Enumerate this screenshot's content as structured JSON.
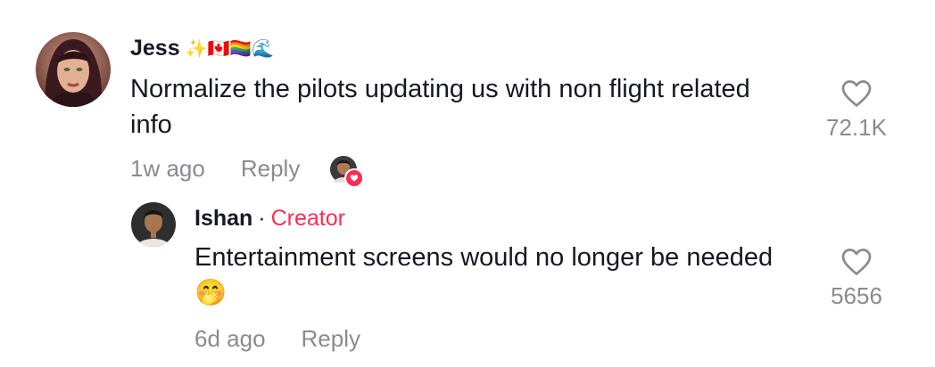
{
  "comments": [
    {
      "username": "Jess",
      "badges": "✨🇨🇦🏳️‍🌈🌊",
      "text": "Normalize the pilots updating us with non flight related info",
      "time": "1w ago",
      "reply_label": "Reply",
      "likes": "72.1K",
      "creator_liked": true
    }
  ],
  "replies": [
    {
      "username": "Ishan",
      "separator": "·",
      "creator_label": "Creator",
      "text": "Entertainment screens would no longer be needed",
      "emoji": "🤭",
      "time": "6d ago",
      "reply_label": "Reply",
      "likes": "5656"
    }
  ],
  "icons": {
    "like": "heart-outline-icon",
    "creator_like": "heart-filled-icon"
  },
  "colors": {
    "text": "#161823",
    "secondary": "#8a8b91",
    "accent": "#fe2c55"
  }
}
